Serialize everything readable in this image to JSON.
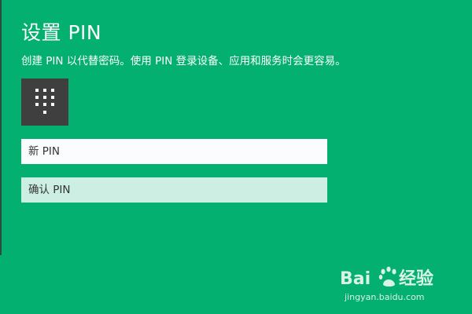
{
  "dialog": {
    "title": "设置 PIN",
    "subtitle": "创建 PIN 以代替密码。使用 PIN 登录设备、应用和服务时会更容易。",
    "icon": "keypad-icon"
  },
  "fields": {
    "new_pin_placeholder": "新 PIN",
    "confirm_pin_placeholder": "确认 PIN"
  },
  "watermark": {
    "brand": "Baidu经验",
    "url": "jingyan.baidu.com"
  },
  "colors": {
    "background": "#03b06f",
    "tile": "#3f3f3f",
    "new_field_bg": "#fbfcfd",
    "confirm_field_bg": "#cdeee3"
  }
}
